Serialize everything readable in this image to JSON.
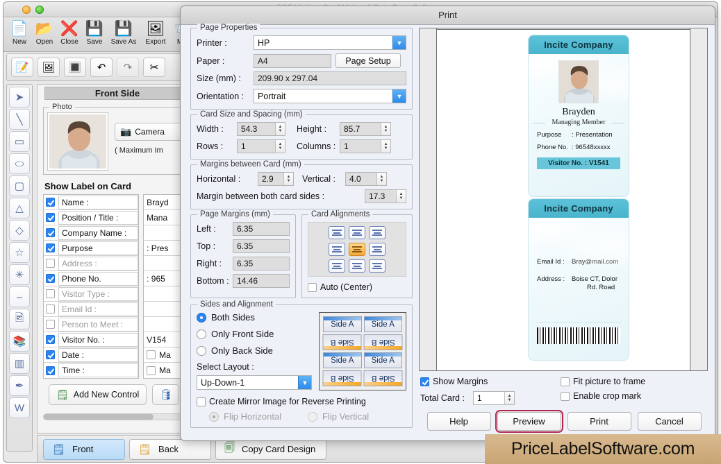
{
  "background_window": {
    "title": "PDF Visiting Card Maker & Data Base Software",
    "toolbar": [
      {
        "label": "New",
        "icon": "new-document-icon"
      },
      {
        "label": "Open",
        "icon": "open-folder-icon"
      },
      {
        "label": "Close",
        "icon": "close-document-icon"
      },
      {
        "label": "Save",
        "icon": "save-floppy-icon"
      },
      {
        "label": "Save As",
        "icon": "save-as-icon"
      },
      {
        "label": "Export",
        "icon": "export-icon"
      },
      {
        "label": "Mail",
        "icon": "mail-envelope-icon"
      }
    ],
    "subtoolbar": [
      {
        "icon": "text-note-icon"
      },
      {
        "icon": "insert-image-icon"
      },
      {
        "icon": "export-image-icon"
      },
      {
        "icon": "undo-arrow-icon"
      },
      {
        "icon": "redo-arrow-icon"
      },
      {
        "icon": "cut-scissors-icon"
      }
    ],
    "palette": [
      {
        "icon": "pointer-cursor-icon"
      },
      {
        "icon": "line-tool-icon"
      },
      {
        "icon": "rectangle-tool-icon"
      },
      {
        "icon": "ellipse-tool-icon"
      },
      {
        "icon": "rounded-rectangle-tool-icon"
      },
      {
        "icon": "triangle-tool-icon"
      },
      {
        "icon": "diamond-tool-icon"
      },
      {
        "icon": "star-tool-icon"
      },
      {
        "icon": "burst-tool-icon"
      },
      {
        "icon": "arc-tool-icon"
      },
      {
        "icon": "image-tool-icon"
      },
      {
        "icon": "books-tool-icon"
      },
      {
        "icon": "barcode-tool-icon"
      },
      {
        "icon": "signature-tool-icon"
      },
      {
        "icon": "watermark-tool-icon"
      }
    ],
    "side_header": "Front Side",
    "photo_group_legend": "Photo",
    "camera_button": "Camera",
    "max_info": "( Maximum Im",
    "show_label_title": "Show Label on Card",
    "label_rows": [
      {
        "label": "Name :",
        "checked": true,
        "enabled": true,
        "value": "Brayd"
      },
      {
        "label": "Position / Title :",
        "checked": true,
        "enabled": true,
        "value": "Mana"
      },
      {
        "label": "Company Name :",
        "checked": true,
        "enabled": true,
        "value": ""
      },
      {
        "label": "Purpose",
        "checked": true,
        "enabled": true,
        "value": ": Pres"
      },
      {
        "label": "Address :",
        "checked": false,
        "enabled": false,
        "value": ""
      },
      {
        "label": "Phone No.",
        "checked": true,
        "enabled": true,
        "value": ": 965"
      },
      {
        "label": "Visitor Type :",
        "checked": false,
        "enabled": false,
        "value": ""
      },
      {
        "label": "Email Id :",
        "checked": false,
        "enabled": false,
        "value": ""
      },
      {
        "label": "Person to Meet :",
        "checked": false,
        "enabled": false,
        "value": ""
      },
      {
        "label": "Visitor No. :",
        "checked": true,
        "enabled": true,
        "value": "V154"
      },
      {
        "label": "Date :",
        "checked": true,
        "enabled": true,
        "value": "Ma"
      },
      {
        "label": "Time :",
        "checked": true,
        "enabled": true,
        "value": "Ma"
      }
    ],
    "add_new_control": "Add New Control",
    "database_icon": "database-icon",
    "tabs": [
      {
        "label": "Front",
        "active": true,
        "icon": "front-card-icon"
      },
      {
        "label": "Back",
        "active": false,
        "icon": "back-card-icon"
      },
      {
        "label": "Copy Card Design",
        "active": false,
        "icon": "copy-card-icon"
      }
    ]
  },
  "dialog": {
    "title": "Print",
    "page_properties": {
      "legend": "Page Properties",
      "printer_label": "Printer :",
      "printer_value": "HP",
      "paper_label": "Paper :",
      "paper_value": "A4",
      "page_setup_button": "Page Setup",
      "size_label": "Size (mm) :",
      "size_value": "209.90 x 297.04",
      "orientation_label": "Orientation :",
      "orientation_value": "Portrait"
    },
    "card_size": {
      "legend": "Card Size and Spacing (mm)",
      "width_label": "Width :",
      "width_value": "54.3",
      "height_label": "Height :",
      "height_value": "85.7",
      "rows_label": "Rows :",
      "rows_value": "1",
      "columns_label": "Columns :",
      "columns_value": "1"
    },
    "margins_between": {
      "legend": "Margins between Card (mm)",
      "horizontal_label": "Horizontal :",
      "horizontal_value": "2.9",
      "vertical_label": "Vertical :",
      "vertical_value": "4.0",
      "both_sides_label": "Margin between both card sides :",
      "both_sides_value": "17.3"
    },
    "page_margins": {
      "legend": "Page Margins (mm)",
      "left_label": "Left :",
      "left_value": "6.35",
      "top_label": "Top :",
      "top_value": "6.35",
      "right_label": "Right :",
      "right_value": "6.35",
      "bottom_label": "Bottom :",
      "bottom_value": "14.46"
    },
    "card_alignments": {
      "legend": "Card Alignments",
      "selected_index": 4,
      "auto_center_label": "Auto (Center)",
      "auto_center_checked": false
    },
    "sides": {
      "legend": "Sides and Alignment",
      "options": [
        {
          "label": "Both Sides",
          "selected": true
        },
        {
          "label": "Only Front Side",
          "selected": false
        },
        {
          "label": "Only Back Side",
          "selected": false
        }
      ],
      "select_layout_label": "Select Layout :",
      "select_layout_value": "Up-Down-1",
      "mirror_label": "Create Mirror Image for Reverse Printing",
      "mirror_checked": false,
      "flip_horizontal_label": "Flip Horizontal",
      "flip_horizontal_selected": true,
      "flip_vertical_label": "Flip Vertical",
      "flip_vertical_selected": false,
      "preview_cells": [
        "Side A",
        "Side A",
        "Side B",
        "Side B",
        "Side A",
        "Side A",
        "Side B",
        "Side B"
      ]
    },
    "options": {
      "show_margins_label": "Show Margins",
      "show_margins_checked": true,
      "total_card_label": "Total Card :",
      "total_card_value": "1",
      "fit_picture_label": "Fit picture to frame",
      "fit_picture_checked": false,
      "crop_mark_label": "Enable crop mark",
      "crop_mark_checked": false
    },
    "buttons": [
      {
        "label": "Help",
        "focused": false
      },
      {
        "label": "Preview",
        "focused": true
      },
      {
        "label": "Print",
        "focused": false
      },
      {
        "label": "Cancel",
        "focused": false
      }
    ]
  },
  "preview": {
    "front_card": {
      "company": "Incite Company",
      "name": "Brayden",
      "role": "Managing Member",
      "purpose_key": "Purpose",
      "purpose_value": ": Presentation",
      "phone_key": "Phone No.",
      "phone_value": ": 96548xxxxx",
      "visitor_badge": "Visitor No. : V1541"
    },
    "back_card": {
      "company": "Incite Company",
      "email_key": "Email Id :",
      "email_value": "Bray@mail.com",
      "address_key": "Address :",
      "address_value_line1": "Boise CT, Dolor",
      "address_value_line2": "Rd. Road",
      "barcode_icon": "barcode-icon"
    }
  },
  "watermark": {
    "text": "PriceLabelSoftware.com"
  },
  "colors": {
    "accent_blue": "#2c84f2",
    "card_teal": "#49b4cc",
    "focus_red": "#b2264b",
    "align_selected": "#f6a93c"
  }
}
